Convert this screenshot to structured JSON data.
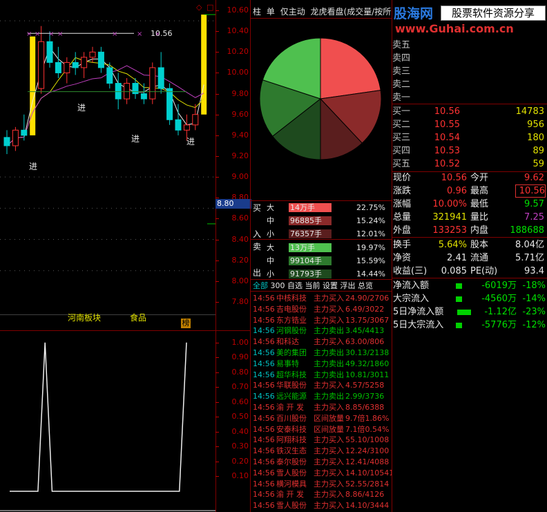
{
  "brand": {
    "logo_text": "股海网",
    "slogan": "股票软件资源分享",
    "url": "www.Guhai.com.cn"
  },
  "toolbar": {
    "tabs": [
      "柱",
      "单",
      "仅主动",
      "龙虎看盘(成交量/按所有"
    ]
  },
  "price_axis": {
    "ticks": [
      "10.60",
      "10.40",
      "10.20",
      "10.00",
      "9.80",
      "9.60",
      "9.40",
      "9.20",
      "9.00",
      "8.80",
      "8.60",
      "8.40",
      "8.20",
      "8.00",
      "7.80"
    ],
    "current_marker": "8.80",
    "high_label": "10.56"
  },
  "chart_markers": {
    "buy_labels": [
      "进",
      "进",
      "进",
      "进"
    ]
  },
  "chart_data": {
    "type": "candlestick",
    "candles": [
      {
        "o": 9.38,
        "h": 9.45,
        "l": 9.22,
        "c": 9.3
      },
      {
        "o": 9.3,
        "h": 9.48,
        "l": 9.25,
        "c": 9.45
      },
      {
        "o": 9.45,
        "h": 9.6,
        "l": 9.35,
        "c": 9.4
      },
      {
        "o": 9.4,
        "h": 10.35,
        "l": 9.4,
        "c": 10.33
      },
      {
        "o": 9.85,
        "h": 10.45,
        "l": 9.8,
        "c": 10.3
      },
      {
        "o": 10.3,
        "h": 10.4,
        "l": 10.05,
        "c": 10.1
      },
      {
        "o": 10.1,
        "h": 10.25,
        "l": 9.95,
        "c": 10.0
      },
      {
        "o": 10.0,
        "h": 10.15,
        "l": 9.9,
        "c": 10.1
      },
      {
        "o": 10.1,
        "h": 10.2,
        "l": 9.98,
        "c": 10.05
      },
      {
        "o": 10.05,
        "h": 10.2,
        "l": 9.95,
        "c": 10.15
      },
      {
        "o": 10.15,
        "h": 10.25,
        "l": 10.1,
        "c": 10.2
      },
      {
        "o": 10.2,
        "h": 10.25,
        "l": 10.0,
        "c": 10.05
      },
      {
        "o": 10.05,
        "h": 10.1,
        "l": 9.85,
        "c": 9.9
      },
      {
        "o": 9.9,
        "h": 10.0,
        "l": 9.65,
        "c": 9.75
      },
      {
        "o": 9.75,
        "h": 9.95,
        "l": 9.7,
        "c": 9.9
      },
      {
        "o": 9.9,
        "h": 9.95,
        "l": 9.75,
        "c": 9.8
      },
      {
        "o": 9.8,
        "h": 9.9,
        "l": 9.7,
        "c": 9.75
      },
      {
        "o": 9.75,
        "h": 10.1,
        "l": 9.7,
        "c": 10.05
      },
      {
        "o": 10.05,
        "h": 10.2,
        "l": 9.8,
        "c": 9.85
      },
      {
        "o": 9.85,
        "h": 9.9,
        "l": 9.5,
        "c": 9.55
      },
      {
        "o": 9.55,
        "h": 9.7,
        "l": 9.4,
        "c": 9.45
      },
      {
        "o": 9.45,
        "h": 9.6,
        "l": 9.35,
        "c": 9.5
      },
      {
        "o": 9.5,
        "h": 9.7,
        "l": 9.45,
        "c": 9.6
      },
      {
        "o": 9.6,
        "h": 10.56,
        "l": 9.6,
        "c": 10.56
      }
    ],
    "ylim": [
      7.7,
      10.7
    ],
    "pie": {
      "slices": [
        {
          "name": "买大",
          "value": 22.75,
          "color": "#f04f4f"
        },
        {
          "name": "买中",
          "value": 15.24,
          "color": "#8b2a2a"
        },
        {
          "name": "买小",
          "value": 12.01,
          "color": "#5a1e1e"
        },
        {
          "name": "卖小",
          "value": 14.44,
          "color": "#1e4a1e"
        },
        {
          "name": "卖中",
          "value": 15.59,
          "color": "#2e7a2e"
        },
        {
          "name": "卖大",
          "value": 19.97,
          "color": "#4fc04f"
        }
      ]
    },
    "indicator": {
      "ylim": [
        0,
        1.05
      ],
      "ticks": [
        "1.00",
        "0.90",
        "0.80",
        "0.70",
        "0.60",
        "0.50",
        "0.40",
        "0.30",
        "0.20",
        "0.10"
      ],
      "values": [
        0,
        0,
        0,
        0,
        0,
        1,
        0,
        0,
        0,
        0,
        0,
        0,
        0,
        0,
        0,
        0,
        0,
        0,
        0,
        0,
        0,
        0,
        0,
        0,
        0,
        1
      ]
    }
  },
  "lower_tabs": {
    "sector": "河南板块",
    "industry": "食品",
    "tag": "榜"
  },
  "flow_table": {
    "buy_side_label": "买",
    "in_label": "入",
    "sell_side_label": "卖",
    "out_label": "出",
    "rows": [
      {
        "side": "大",
        "amount": "14万手",
        "pct": "22.75%",
        "color": "#f04f4f"
      },
      {
        "side": "中",
        "amount": "96885手",
        "pct": "15.24%",
        "color": "#8b2a2a"
      },
      {
        "side": "小",
        "amount": "76357手",
        "pct": "12.01%",
        "color": "#5a1e1e"
      },
      {
        "side": "大",
        "amount": "13万手",
        "pct": "19.97%",
        "color": "#4fc04f"
      },
      {
        "side": "中",
        "amount": "99104手",
        "pct": "15.59%",
        "color": "#2e7a2e"
      },
      {
        "side": "小",
        "amount": "91793手",
        "pct": "14.44%",
        "color": "#1e4a1e"
      }
    ]
  },
  "ticker_tabs": [
    "全部",
    "300",
    "自选",
    "当前",
    "设置",
    "浮出",
    "总览"
  ],
  "ticker": [
    {
      "time": "14:56",
      "name": "中核科技",
      "action": "主力买入",
      "detail": "24.90/2706",
      "color": "red"
    },
    {
      "time": "14:56",
      "name": "吉电股份",
      "action": "主力买入",
      "detail": "6.49/3022",
      "color": "red"
    },
    {
      "time": "14:56",
      "name": "东方锆业",
      "action": "主力买入",
      "detail": "13.75/3067",
      "color": "red"
    },
    {
      "time": "14:56",
      "name": "河钢股份",
      "action": "主力卖出",
      "detail": "3.45/4413",
      "color": "green"
    },
    {
      "time": "14:56",
      "name": "和科达",
      "action": "主力买入",
      "detail": "63.00/806",
      "color": "red"
    },
    {
      "time": "14:56",
      "name": "美的集团",
      "action": "主力卖出",
      "detail": "30.13/2138",
      "color": "green"
    },
    {
      "time": "14:56",
      "name": "易事特",
      "action": "主力卖出",
      "detail": "49.32/1860",
      "color": "green"
    },
    {
      "time": "14:56",
      "name": "超华科技",
      "action": "主力卖出",
      "detail": "10.81/3011",
      "color": "green"
    },
    {
      "time": "14:56",
      "name": "华联股份",
      "action": "主力买入",
      "detail": "4.57/5258",
      "color": "red"
    },
    {
      "time": "14:56",
      "name": "远兴能源",
      "action": "主力卖出",
      "detail": "2.99/3736",
      "color": "green"
    },
    {
      "time": "14:56",
      "name": "渝 开 发",
      "action": "主力买入",
      "detail": "8.85/6388",
      "color": "red"
    },
    {
      "time": "14:56",
      "name": "百川股份",
      "action": "区间放量",
      "detail": "9.7倍1.86%",
      "color": "red"
    },
    {
      "time": "14:56",
      "name": "安泰科技",
      "action": "区间放量",
      "detail": "7.1倍0.54%",
      "color": "red"
    },
    {
      "time": "14:56",
      "name": "阿翔科技",
      "action": "主力买入",
      "detail": "55.10/1008",
      "color": "red"
    },
    {
      "time": "14:56",
      "name": "铁汉生态",
      "action": "主力买入",
      "detail": "12.24/3100",
      "color": "red"
    },
    {
      "time": "14:56",
      "name": "泰尔股份",
      "action": "主力买入",
      "detail": "12.41/4088",
      "color": "red"
    },
    {
      "time": "14:56",
      "name": "雪人股份",
      "action": "主力买入",
      "detail": "14.10/10541",
      "color": "red"
    },
    {
      "time": "14:56",
      "name": "横河模具",
      "action": "主力买入",
      "detail": "52.55/2814",
      "color": "red"
    },
    {
      "time": "14:56",
      "name": "渝 开 发",
      "action": "主力买入",
      "detail": "8.86/4126",
      "color": "red"
    },
    {
      "time": "14:56",
      "name": "雪人股份",
      "action": "主力买入",
      "detail": "14.10/3444",
      "color": "red"
    }
  ],
  "order_book": {
    "asks": [
      {
        "label": "卖五",
        "price": "",
        "vol": ""
      },
      {
        "label": "卖四",
        "price": "",
        "vol": ""
      },
      {
        "label": "卖三",
        "price": "",
        "vol": ""
      },
      {
        "label": "卖二",
        "price": "",
        "vol": ""
      },
      {
        "label": "卖一",
        "price": "",
        "vol": ""
      }
    ],
    "bids": [
      {
        "label": "买一",
        "price": "10.56",
        "vol": "14783"
      },
      {
        "label": "买二",
        "price": "10.55",
        "vol": "956"
      },
      {
        "label": "买三",
        "price": "10.54",
        "vol": "180"
      },
      {
        "label": "买四",
        "price": "10.53",
        "vol": "89"
      },
      {
        "label": "买五",
        "price": "10.52",
        "vol": "59"
      }
    ]
  },
  "quote": {
    "current_label": "现价",
    "current": "10.56",
    "open_label": "今开",
    "open": "9.62",
    "change_label": "涨跌",
    "change": "0.96",
    "high_label": "最高",
    "high": "10.56",
    "pct_label": "涨幅",
    "pct": "10.00%",
    "low_label": "最低",
    "low": "9.57",
    "volume_label": "总量",
    "volume": "321941",
    "ratio_label": "量比",
    "ratio": "7.25",
    "outer_label": "外盘",
    "outer": "133253",
    "inner_label": "内盘",
    "inner": "188688",
    "turnover_label": "换手",
    "turnover": "5.64%",
    "shares_label": "股本",
    "shares": "8.04亿",
    "netasset_label": "净资",
    "netasset": "2.41",
    "float_label": "流通",
    "float": "5.71亿",
    "eps_label": "收益(三)",
    "eps": "0.085",
    "pe_label": "PE(动)",
    "pe": "93.4"
  },
  "net_flow": [
    {
      "label": "净流入额",
      "value": "-6019万",
      "pct": "-18%"
    },
    {
      "label": "大宗流入",
      "value": "-4560万",
      "pct": "-14%"
    },
    {
      "label": "5日净流入额",
      "value": "-1.12亿",
      "pct": "-23%"
    },
    {
      "label": "5日大宗流入",
      "value": "-5776万",
      "pct": "-12%"
    }
  ]
}
